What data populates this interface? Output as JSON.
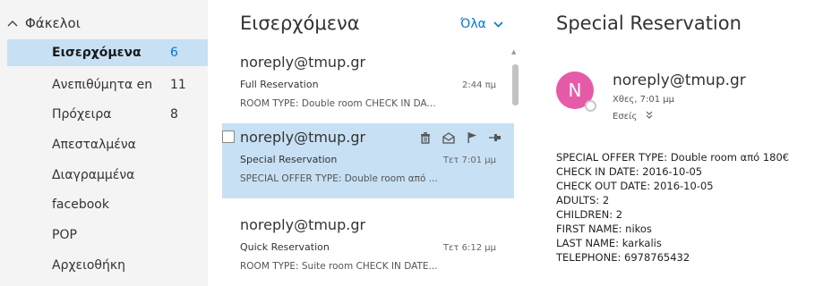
{
  "folders": {
    "header": "Φάκελοι",
    "items": [
      {
        "label": "Εισερχόμενα",
        "count": "6",
        "selected": true
      },
      {
        "label": "Ανεπιθύμητα en",
        "count": "11"
      },
      {
        "label": "Πρόχειρα",
        "count": "8"
      },
      {
        "label": "Απεσταλμένα",
        "count": ""
      },
      {
        "label": "Διαγραμμένα",
        "count": ""
      },
      {
        "label": "facebook",
        "count": ""
      },
      {
        "label": "POP",
        "count": ""
      },
      {
        "label": "Αρχειοθήκη",
        "count": ""
      }
    ]
  },
  "list": {
    "title": "Εισερχόμενα",
    "filter": "Όλα",
    "messages": [
      {
        "sender": "noreply@tmup.gr",
        "subject": "Full Reservation",
        "time": "2:44 πμ",
        "preview": "ROOM TYPE: Double room CHECK IN DA..."
      },
      {
        "sender": "noreply@tmup.gr",
        "subject": "Special Reservation",
        "time": "Τετ 7:01 μμ",
        "preview": "SPECIAL OFFER TYPE: Double room από ..."
      },
      {
        "sender": "noreply@tmup.gr",
        "subject": "Quick Reservation",
        "time": "Τετ 6:12 μμ",
        "preview": "ROOM TYPE: Suite room CHECK IN DATE..."
      }
    ]
  },
  "reading": {
    "title": "Special Reservation",
    "avatar_letter": "N",
    "from": "noreply@tmup.gr",
    "date": "Χθες, 7:01 μμ",
    "to": "Εσείς",
    "body": [
      "SPECIAL OFFER TYPE: Double room από 180€",
      "CHECK IN DATE: 2016-10-05",
      "CHECK OUT DATE: 2016-10-05",
      "ADULTS: 2",
      "CHILDREN: 2",
      "FIRST NAME: nikos",
      "LAST NAME: karkalis",
      "TELEPHONE: 6978765432"
    ]
  },
  "colors": {
    "accent": "#0078d7",
    "selection": "#c7e0f4",
    "avatar": "#e55ba8",
    "folder_pane": "#f4f4f4"
  },
  "icons": {
    "folders_toggle": "chevron-up-icon",
    "filter": "chevron-down-icon",
    "msg_actions": [
      "trash-icon",
      "mark-read-icon",
      "flag-icon",
      "pin-icon"
    ],
    "to_expand": "double-chevron-down-icon"
  }
}
